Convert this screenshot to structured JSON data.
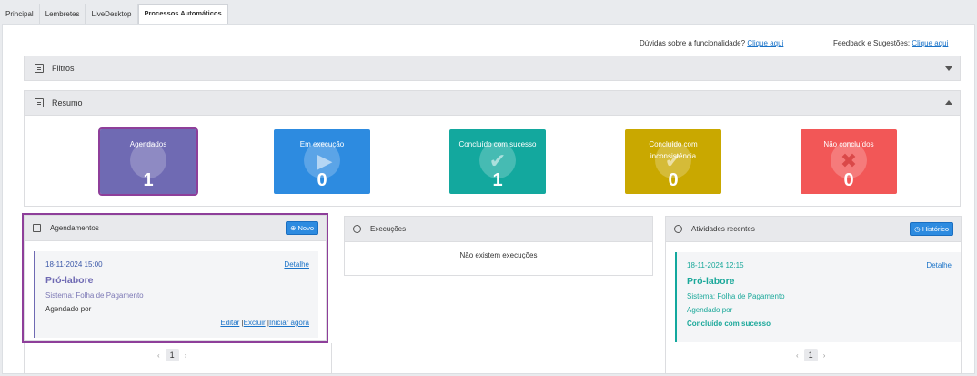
{
  "tabs": [
    "Principal",
    "Lembretes",
    "LiveDesktop",
    "Processos Automáticos"
  ],
  "help": {
    "question": "Dúvidas sobre a funcionalidade?",
    "question_link": "Clique aqui",
    "feedback": "Feedback e Sugestões:",
    "feedback_link": "Clique aqui"
  },
  "filtros": {
    "label": "Filtros"
  },
  "resumo": {
    "label": "Resumo",
    "cards": [
      {
        "label": "Agendados",
        "value": "1",
        "color": "#6f6ab3",
        "icon": "calendar-icon"
      },
      {
        "label": "Em execução",
        "value": "0",
        "color": "#2d8be0",
        "icon": "play-icon"
      },
      {
        "label": "Concluído com sucesso",
        "value": "1",
        "color": "#13a89e",
        "icon": "check-icon"
      },
      {
        "label": "Concluído com inconsistência",
        "value": "0",
        "color": "#c9a800",
        "icon": "check-icon"
      },
      {
        "label": "Não concluídos",
        "value": "0",
        "color": "#f25757",
        "icon": "x-icon"
      }
    ]
  },
  "agendamentos": {
    "title": "Agendamentos",
    "new_button": "Novo",
    "item": {
      "date": "18-11-2024 15:00",
      "detail": "Detalhe",
      "title": "Pró-labore",
      "system": "Sistema: Folha de Pagamento",
      "by": "Agendado por",
      "edit": "Editar",
      "delete": "Excluir",
      "start": "Iniciar agora"
    },
    "page": "1"
  },
  "execucoes": {
    "title": "Execuções",
    "empty": "Não existem execuções"
  },
  "atividades": {
    "title": "Atividades recentes",
    "history_button": "Histórico",
    "item": {
      "date": "18-11-2024 12:15",
      "detail": "Detalhe",
      "title": "Pró-labore",
      "system": "Sistema: Folha de Pagamento",
      "by": "Agendado por",
      "status": "Concluído com sucesso"
    },
    "page": "1"
  }
}
